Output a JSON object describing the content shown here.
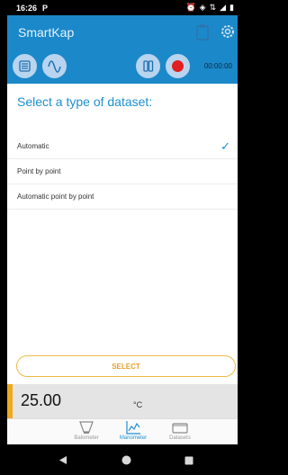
{
  "status_bar": {
    "time": "16:26",
    "app_badge": "P"
  },
  "app_bar": {
    "title": "SmartKap"
  },
  "toolbar": {
    "timer": "00:00:00"
  },
  "heading": "Select a type of dataset:",
  "options": [
    {
      "label": "Automatic",
      "selected": true
    },
    {
      "label": "Point by point",
      "selected": false
    },
    {
      "label": "Automatic point by point",
      "selected": false
    }
  ],
  "select_button": "SELECT",
  "readout": {
    "value": "25.00",
    "unit": "°C"
  },
  "tabs": [
    {
      "label": "Balometer",
      "active": false
    },
    {
      "label": "Manometer",
      "active": true
    },
    {
      "label": "Datasets",
      "active": false
    }
  ],
  "colors": {
    "primary": "#1b88c9",
    "accent": "#f0a81e"
  }
}
